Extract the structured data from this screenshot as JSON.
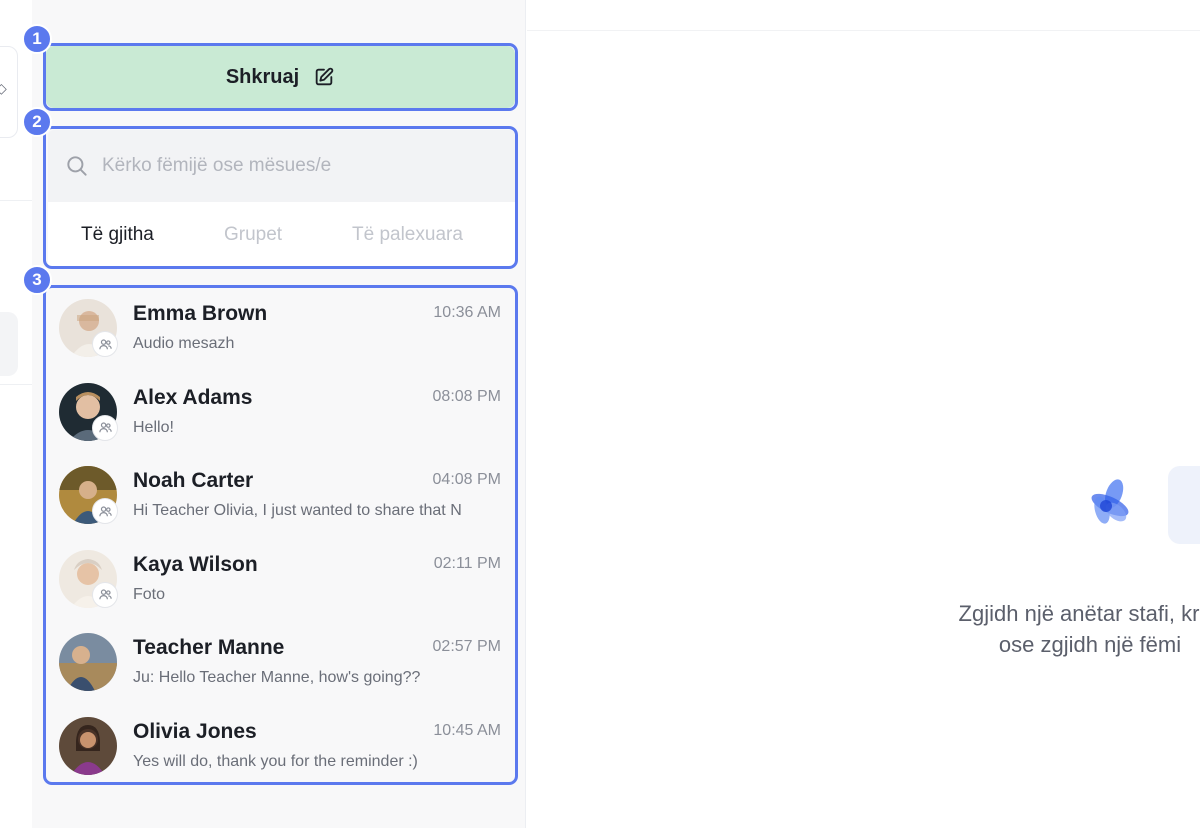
{
  "compose": {
    "label": "Shkruaj",
    "icon": "edit-icon"
  },
  "search": {
    "placeholder": "Kërko fëmijë ose mësues/e",
    "icon": "search-icon"
  },
  "tabs": [
    {
      "label": "Të gjitha",
      "active": true
    },
    {
      "label": "Grupet",
      "active": false
    },
    {
      "label": "Të palexuara",
      "active": false
    }
  ],
  "conversations": [
    {
      "name": "Emma Brown",
      "time": "10:36 AM",
      "preview": "Audio mesazh"
    },
    {
      "name": "Alex Adams",
      "time": "08:08 PM",
      "preview": "Hello!"
    },
    {
      "name": "Noah Carter",
      "time": "04:08 PM",
      "preview": "Hi Teacher Olivia, I just wanted to share that N"
    },
    {
      "name": "Kaya Wilson",
      "time": "02:11 PM",
      "preview": "Foto"
    },
    {
      "name": "Teacher Manne",
      "time": "02:57 PM",
      "preview": "Ju: Hello Teacher Manne, how's going??"
    },
    {
      "name": "Olivia Jones",
      "time": "10:45 AM",
      "preview": "Yes will do, thank you for the reminder :)"
    }
  ],
  "annotations": [
    "1",
    "2",
    "3"
  ],
  "empty_state": {
    "line1": "Zgjidh një anëtar stafi, krijo",
    "line2": "ose zgjidh një fëmi"
  },
  "colors": {
    "compose_bg": "#c9ead4",
    "annotation": "#5b79ee",
    "panel_bg": "#f8f8f9",
    "logo_blue": "#3f6bf0"
  }
}
